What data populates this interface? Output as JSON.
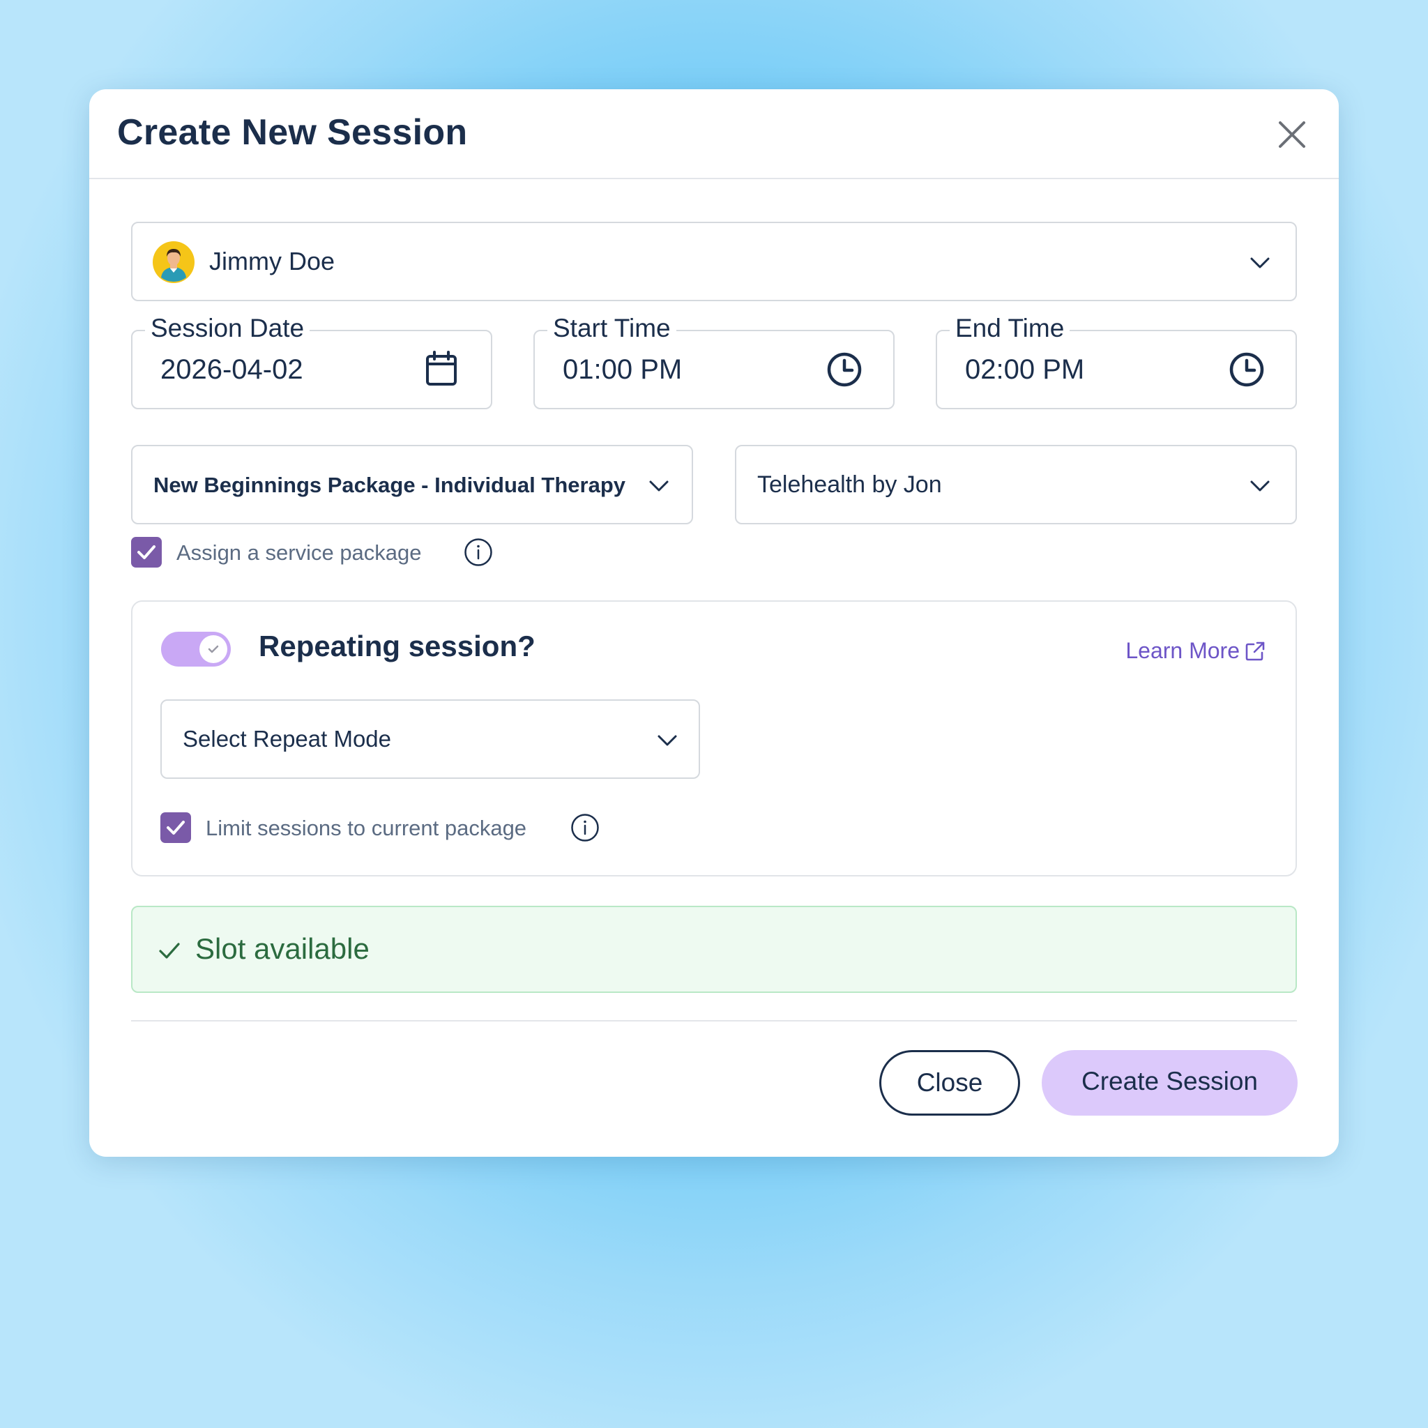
{
  "modal": {
    "title": "Create New Session"
  },
  "client": {
    "name": "Jimmy Doe"
  },
  "session_date": {
    "label": "Session Date",
    "value": "2026-04-02"
  },
  "start_time": {
    "label": "Start Time",
    "value": "01:00 PM"
  },
  "end_time": {
    "label": "End Time",
    "value": "02:00 PM"
  },
  "service_package": {
    "value": "New Beginnings Package - Individual Therapy"
  },
  "location": {
    "value": "Telehealth by Jon"
  },
  "assign_package": {
    "label": "Assign a service package",
    "checked": true
  },
  "repeating": {
    "title": "Repeating session?",
    "enabled": true,
    "learn_more": "Learn More",
    "repeat_mode_placeholder": "Select Repeat Mode",
    "limit_label": "Limit sessions to current package",
    "limit_checked": true
  },
  "status": {
    "text": "Slot available",
    "color": "#2b6b3f"
  },
  "actions": {
    "close_label": "Close",
    "create_label": "Create Session"
  },
  "colors": {
    "accent_purple": "#7a5aa8",
    "toggle_on": "#c9a8f5",
    "create_button": "#dcc9fb",
    "link": "#6d55c7",
    "text_dark": "#1b2e4b"
  }
}
